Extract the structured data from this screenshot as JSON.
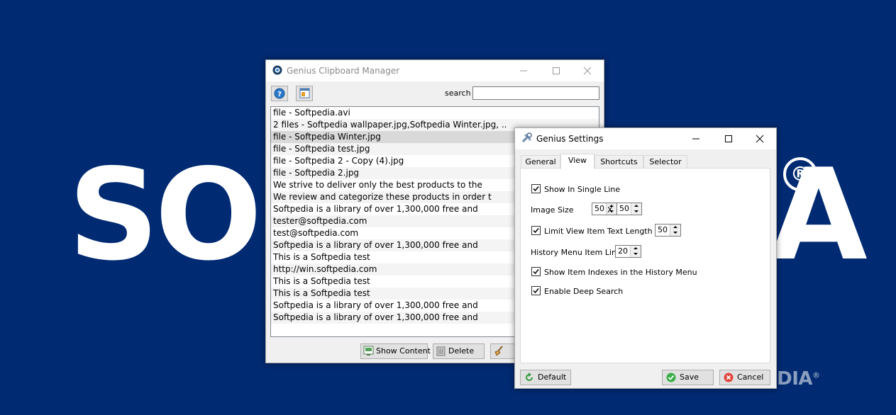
{
  "background": {
    "logo_left": "SO",
    "logo_right": "A",
    "registered_mark": "®",
    "watermark": "SOFTPEDIA",
    "watermark_mark": "®"
  },
  "main_window": {
    "title": "Genius Clipboard Manager",
    "search_label": "search",
    "search_value": "",
    "items": [
      "file - Softpedia.avi",
      "2 files - Softpedia wallpaper.jpg,Softpedia Winter.jpg, ..",
      "file - Softpedia Winter.jpg",
      "file - Softpedia test.jpg",
      "file - Softpedia 2 - Copy (4).jpg",
      "file - Softpedia 2.jpg",
      "We strive to deliver only the best products to the",
      "We review and categorize these products in order t",
      "Softpedia is a library of over 1,300,000 free and",
      "tester@softpedia.com",
      "test@softpedia.com",
      "Softpedia is a library of over 1,300,000 free and",
      "This is a Softpedia test",
      "http://win.softpedia.com",
      "This is a Softpedia test",
      "This is a Softpedia test",
      "Softpedia is a library of over 1,300,000 free and",
      "Softpedia is a library of over 1,300,000 free and"
    ],
    "selected_index": 2,
    "buttons": {
      "show_content": "Show Content",
      "delete": "Delete"
    }
  },
  "settings_window": {
    "title": "Genius Settings",
    "tabs": [
      "General",
      "View",
      "Shortcuts",
      "Selector"
    ],
    "active_tab": "View",
    "show_in_single_line": {
      "label": "Show In Single Line",
      "checked": true
    },
    "image_size": {
      "label": "Image Size",
      "width": "50",
      "separator": "X",
      "height": "50"
    },
    "limit_text_length": {
      "label": "Limit View Item Text Length to",
      "checked": true,
      "value": "50"
    },
    "history_menu_limit": {
      "label": "History Menu Item Limit",
      "value": "20"
    },
    "show_item_indexes": {
      "label": "Show Item Indexes in the History Menu",
      "checked": true
    },
    "enable_deep_search": {
      "label": "Enable Deep Search",
      "checked": true
    },
    "buttons": {
      "default": "Default",
      "save": "Save",
      "cancel": "Cancel"
    }
  }
}
